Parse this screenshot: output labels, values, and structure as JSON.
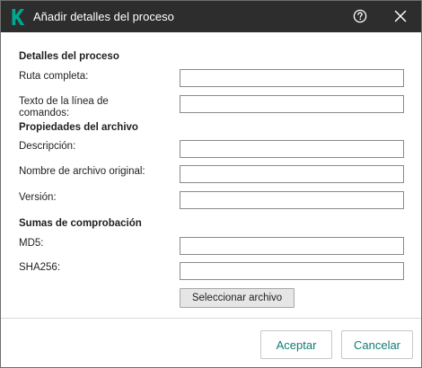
{
  "window": {
    "title": "Añadir detalles del proceso",
    "brand_color": "#00a88e",
    "accent_color": "#0e7d74"
  },
  "icons": {
    "logo": "kaspersky-k-logo-icon",
    "help": "question-circle-icon",
    "close": "close-x-icon"
  },
  "process_details": {
    "section_title": "Detalles del proceso",
    "full_path_label": "Ruta completa:",
    "full_path_value": "",
    "command_line_label": "Texto de la línea de comandos:",
    "command_line_value": ""
  },
  "file_properties": {
    "section_title": "Propiedades del archivo",
    "description_label": "Descripción:",
    "description_value": "",
    "original_name_label": "Nombre de archivo original:",
    "original_name_value": "",
    "version_label": "Versión:",
    "version_value": ""
  },
  "checksums": {
    "section_title": "Sumas de comprobación",
    "md5_label": "MD5:",
    "md5_value": "",
    "sha256_label": "SHA256:",
    "sha256_value": "",
    "select_file_label": "Seleccionar archivo"
  },
  "footer": {
    "accept_label": "Aceptar",
    "cancel_label": "Cancelar"
  }
}
